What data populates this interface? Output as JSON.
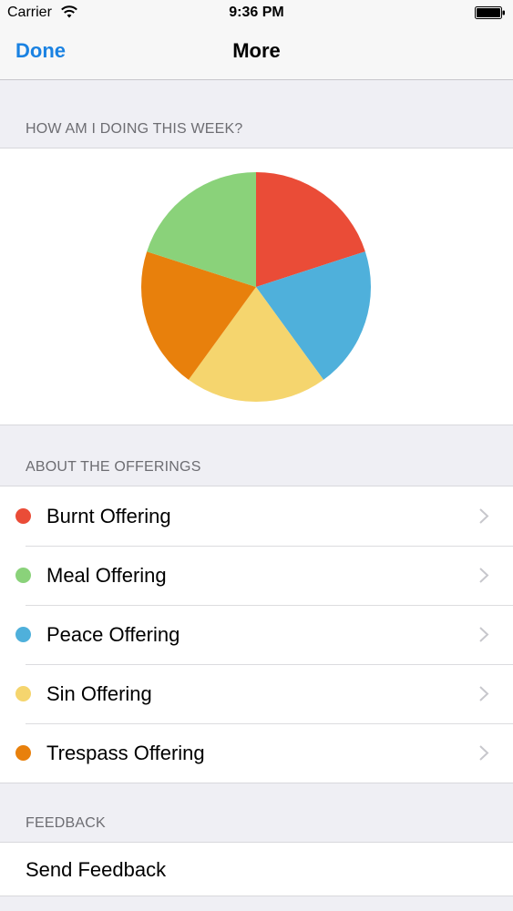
{
  "status_bar": {
    "carrier": "Carrier",
    "time": "9:36 PM"
  },
  "nav": {
    "done_label": "Done",
    "title": "More"
  },
  "sections": {
    "week_header": "HOW AM I DOING THIS WEEK?",
    "offerings_header": "ABOUT THE OFFERINGS",
    "feedback_header": "FEEDBACK"
  },
  "chart_data": {
    "type": "pie",
    "title": "",
    "slices": [
      {
        "label": "Burnt Offering",
        "value": 20,
        "color": "#ea4c37"
      },
      {
        "label": "Peace Offering",
        "value": 20,
        "color": "#4fb0db"
      },
      {
        "label": "Sin Offering",
        "value": 20,
        "color": "#f5d56e"
      },
      {
        "label": "Trespass Offering",
        "value": 20,
        "color": "#e8800c"
      },
      {
        "label": "Meal Offering",
        "value": 20,
        "color": "#8ad27a"
      }
    ]
  },
  "offerings": [
    {
      "label": "Burnt Offering",
      "color": "#ea4c37",
      "icon": "chevron-right-icon"
    },
    {
      "label": "Meal Offering",
      "color": "#8ad27a",
      "icon": "chevron-right-icon"
    },
    {
      "label": "Peace Offering",
      "color": "#4fb0db",
      "icon": "chevron-right-icon"
    },
    {
      "label": "Sin Offering",
      "color": "#f5d56e",
      "icon": "chevron-right-icon"
    },
    {
      "label": "Trespass Offering",
      "color": "#e8800c",
      "icon": "chevron-right-icon"
    }
  ],
  "feedback": {
    "send_label": "Send Feedback"
  },
  "colors": {
    "accent": "#1a82e2",
    "background": "#efeff4"
  }
}
